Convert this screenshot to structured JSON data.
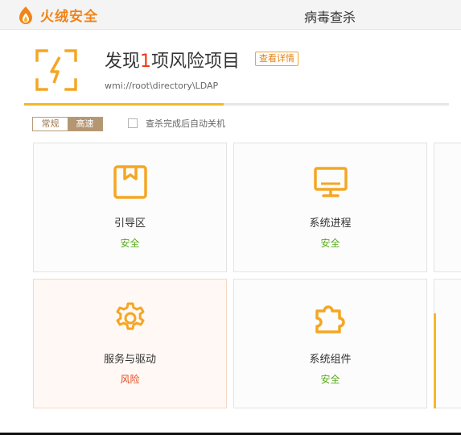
{
  "app": {
    "brand": "火绒安全",
    "title": "病毒查杀"
  },
  "result": {
    "headline_pre": "发现",
    "count": "1",
    "headline_post": "项风险项目",
    "details_button": "查看详情",
    "path": "wmi://root\\directory\\LDAP",
    "progress": 0.47
  },
  "options": {
    "mode_normal": "常规",
    "mode_fast": "高速",
    "selected_mode": "高速",
    "auto_shutdown_label": "查杀完成后自动关机",
    "auto_shutdown_checked": false
  },
  "cards": [
    {
      "label": "引导区",
      "status": "安全",
      "icon": "bookmark-icon"
    },
    {
      "label": "系统进程",
      "status": "安全",
      "icon": "monitor-icon"
    },
    {
      "label": "服务与驱动",
      "status": "风险",
      "icon": "gear-icon"
    },
    {
      "label": "系统组件",
      "status": "安全",
      "icon": "puzzle-icon"
    }
  ],
  "colors": {
    "accent": "#f5a623",
    "brand": "#f08519",
    "safe": "#5aab1e",
    "danger": "#e0461b",
    "count": "#f1350f"
  }
}
